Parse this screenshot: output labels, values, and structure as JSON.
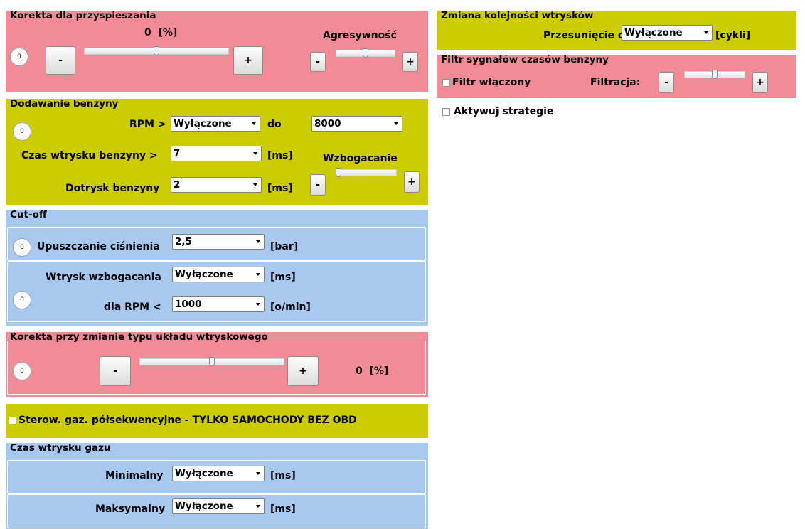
{
  "accel": {
    "title": "Korekta dla przyspieszania",
    "value": "0",
    "unit": "[%]",
    "circle": "0",
    "minus": "-",
    "plus": "+",
    "aggr_label": "Agresywność",
    "aggr_minus": "-",
    "aggr_plus": "+"
  },
  "fuel_add": {
    "title": "Dodawanie benzyny",
    "circle": "0",
    "rpm_label": "RPM >",
    "rpm_value": "Wyłączone",
    "to_label": "do",
    "rpm_to_value": "8000",
    "inj_label": "Czas wtrysku benzyny >",
    "inj_value": "7",
    "inj_unit": "[ms]",
    "enrich_label": "Wzbogacanie",
    "extra_label": "Dotrysk benzyny",
    "extra_value": "2",
    "extra_unit": "[ms]",
    "minus": "-",
    "plus": "+"
  },
  "cutoff": {
    "title": "Cut-off",
    "circle1": "0",
    "pressure_label": "Upuszczanie ciśnienia",
    "pressure_value": "2,5",
    "pressure_unit": "[bar]",
    "circle2": "0",
    "enrich_inj_label": "Wtrysk wzbogacania",
    "enrich_inj_value": "Wyłączone",
    "enrich_inj_unit": "[ms]",
    "rpm_label": "dla RPM <",
    "rpm_value": "1000",
    "rpm_unit": "[o/min]"
  },
  "inj_type": {
    "title": "Korekta przy zmianie typu układu wtryskowego",
    "circle": "0",
    "minus": "-",
    "plus": "+",
    "value": "0",
    "unit": "[%]"
  },
  "semiseq": {
    "label": "Sterow. gaz. półsekwencyjne - TYLKO SAMOCHODY BEZ OBD"
  },
  "gas_time": {
    "title": "Czas wtrysku gazu",
    "min_label": "Minimalny",
    "min_value": "Wyłączone",
    "min_unit": "[ms]",
    "max_label": "Maksymalny",
    "max_value": "Wyłączone",
    "max_unit": "[ms]"
  },
  "order": {
    "title": "Zmiana kolejności wtrysków",
    "shift_label": "Przesunięcie o",
    "shift_value": "Wyłączone",
    "shift_unit": "[cykli]"
  },
  "filter": {
    "title": "Filtr sygnałów czasów benzyny",
    "enabled_label": "Filtr włączony",
    "filtration_label": "Filtracja:",
    "minus": "-",
    "plus": "+"
  },
  "strategy": {
    "label": "Aktywuj strategie"
  },
  "sliders": {
    "accel": 0.5,
    "aggr": 0.5,
    "enrich": 0.05,
    "inj_type": 0.5,
    "filter": 0.5
  }
}
